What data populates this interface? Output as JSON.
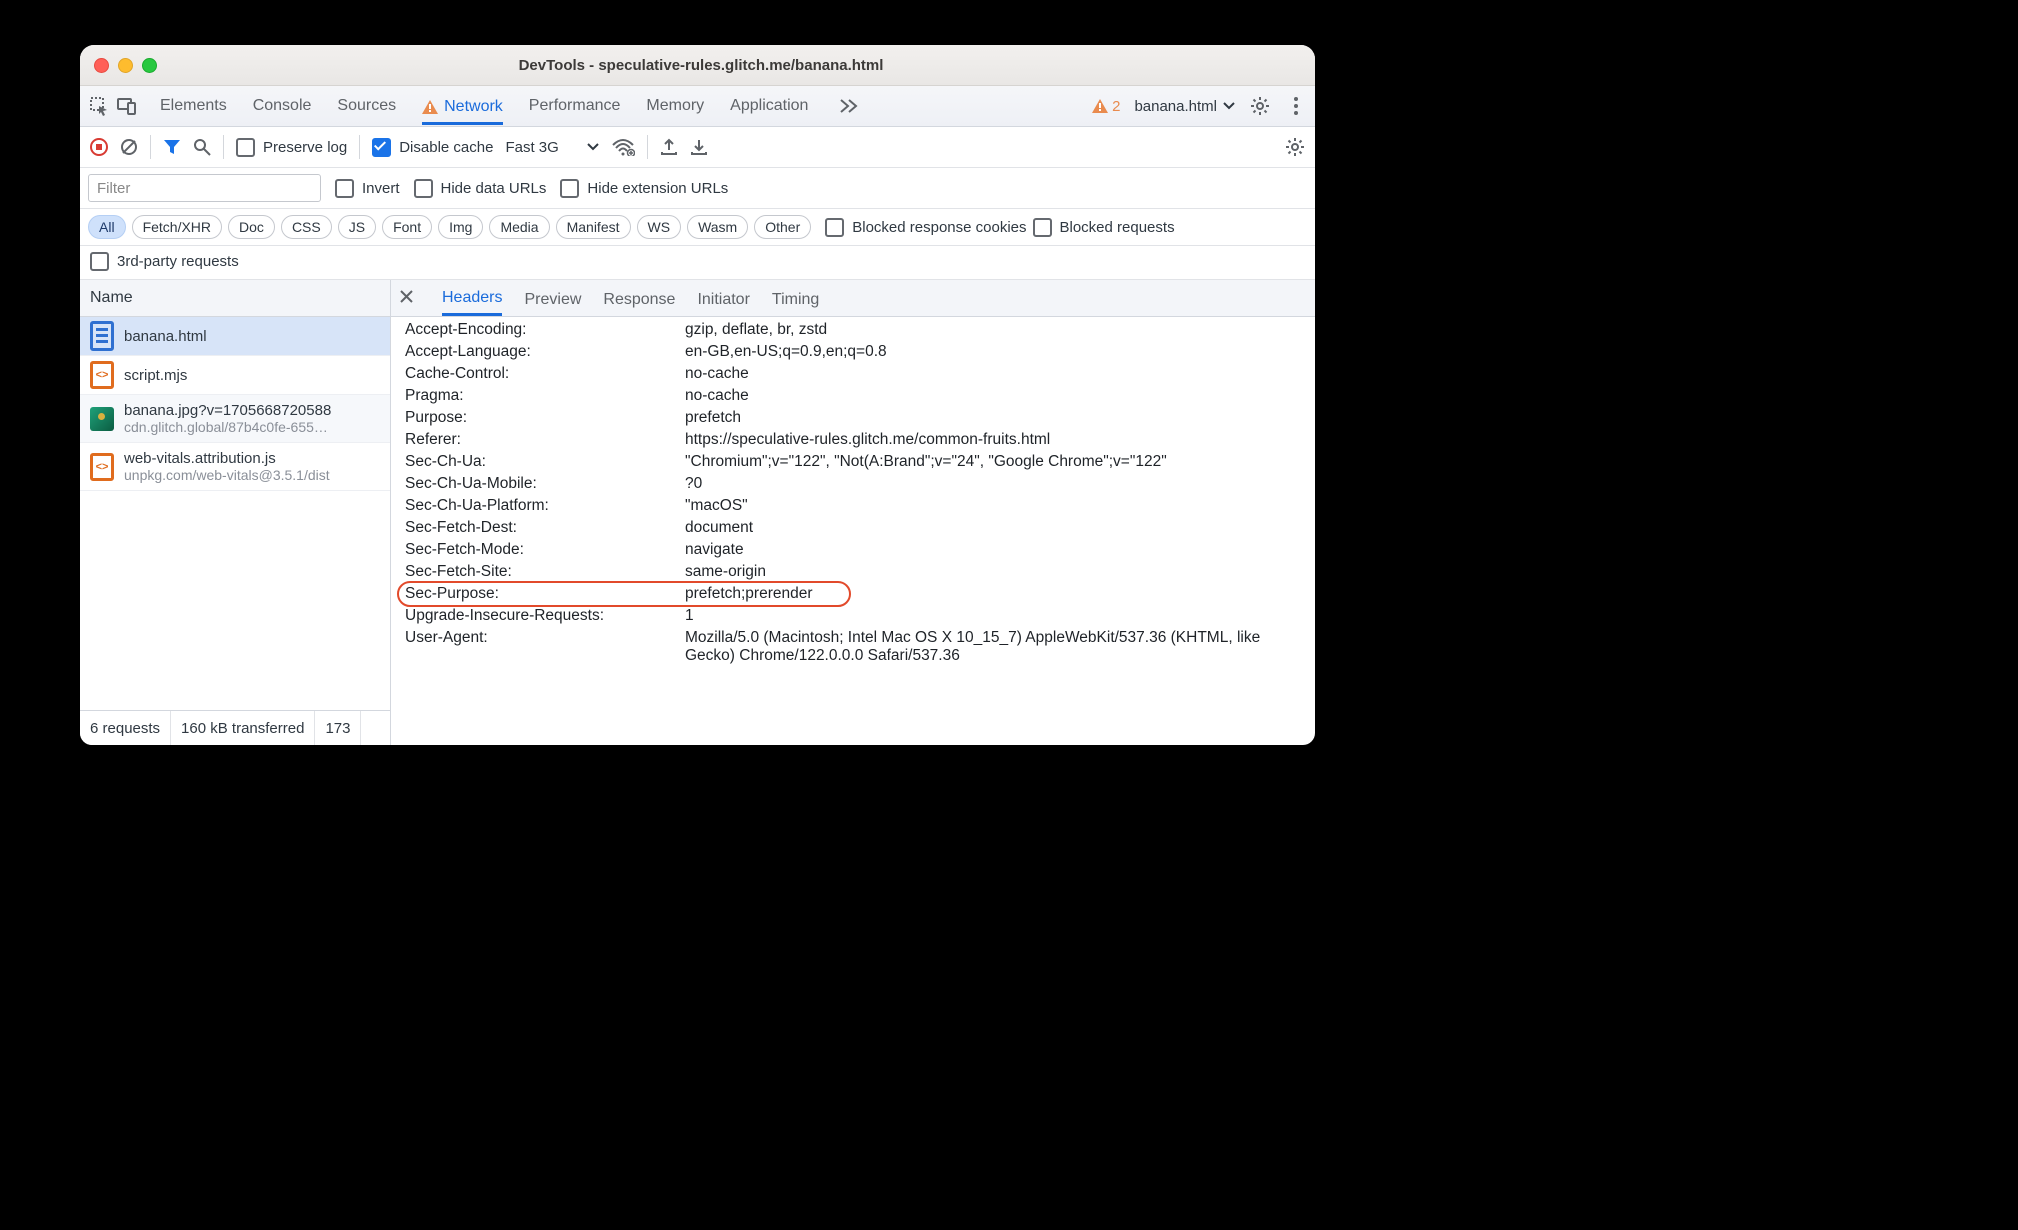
{
  "title": "DevTools - speculative-rules.glitch.me/banana.html",
  "tabs": [
    "Elements",
    "Console",
    "Sources",
    "Network",
    "Performance",
    "Memory",
    "Application"
  ],
  "activeTab": "Network",
  "warnCount": "2",
  "target": "banana.html",
  "toolbar": {
    "preserve": "Preserve log",
    "disableCache": "Disable cache",
    "throttle": "Fast 3G"
  },
  "filter": {
    "placeholder": "Filter",
    "invert": "Invert",
    "hideData": "Hide data URLs",
    "hideExt": "Hide extension URLs"
  },
  "pills": [
    "All",
    "Fetch/XHR",
    "Doc",
    "CSS",
    "JS",
    "Font",
    "Img",
    "Media",
    "Manifest",
    "WS",
    "Wasm",
    "Other"
  ],
  "pillChecks": {
    "brc": "Blocked response cookies",
    "breq": "Blocked requests"
  },
  "thirdParty": "3rd-party requests",
  "leftHeader": "Name",
  "requests": [
    {
      "name": "banana.html",
      "sub": "",
      "icon": "doc",
      "sel": true
    },
    {
      "name": "script.mjs",
      "sub": "",
      "icon": "src"
    },
    {
      "name": "banana.jpg?v=1705668720588",
      "sub": "cdn.glitch.global/87b4c0fe-655…",
      "icon": "img",
      "alt": true
    },
    {
      "name": "web-vitals.attribution.js",
      "sub": "unpkg.com/web-vitals@3.5.1/dist",
      "icon": "src"
    }
  ],
  "status": {
    "reqs": "6 requests",
    "xfer": "160 kB transferred",
    "rest": "173"
  },
  "detailTabs": [
    "Headers",
    "Preview",
    "Response",
    "Initiator",
    "Timing"
  ],
  "activeDetail": "Headers",
  "headers": [
    {
      "k": "Accept-Encoding:",
      "v": "gzip, deflate, br, zstd"
    },
    {
      "k": "Accept-Language:",
      "v": "en-GB,en-US;q=0.9,en;q=0.8"
    },
    {
      "k": "Cache-Control:",
      "v": "no-cache"
    },
    {
      "k": "Pragma:",
      "v": "no-cache"
    },
    {
      "k": "Purpose:",
      "v": "prefetch"
    },
    {
      "k": "Referer:",
      "v": "https://speculative-rules.glitch.me/common-fruits.html"
    },
    {
      "k": "Sec-Ch-Ua:",
      "v": "\"Chromium\";v=\"122\", \"Not(A:Brand\";v=\"24\", \"Google Chrome\";v=\"122\""
    },
    {
      "k": "Sec-Ch-Ua-Mobile:",
      "v": "?0"
    },
    {
      "k": "Sec-Ch-Ua-Platform:",
      "v": "\"macOS\""
    },
    {
      "k": "Sec-Fetch-Dest:",
      "v": "document"
    },
    {
      "k": "Sec-Fetch-Mode:",
      "v": "navigate"
    },
    {
      "k": "Sec-Fetch-Site:",
      "v": "same-origin"
    },
    {
      "k": "Sec-Purpose:",
      "v": "prefetch;prerender",
      "hl": true
    },
    {
      "k": "Upgrade-Insecure-Requests:",
      "v": "1"
    },
    {
      "k": "User-Agent:",
      "v": "Mozilla/5.0 (Macintosh; Intel Mac OS X 10_15_7) AppleWebKit/537.36 (KHTML, like Gecko) Chrome/122.0.0.0 Safari/537.36"
    }
  ]
}
